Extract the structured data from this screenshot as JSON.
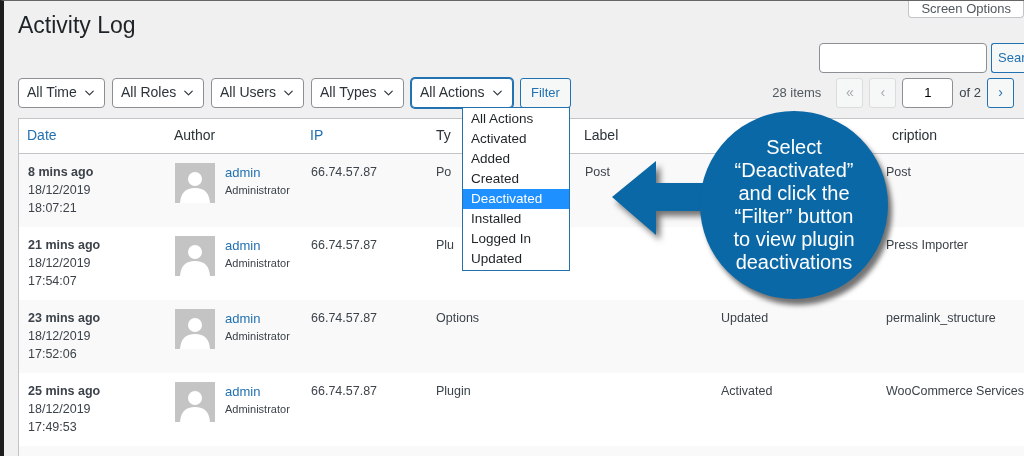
{
  "page": {
    "title": "Activity Log",
    "screen_options": "Screen Options",
    "search_button": "Sear"
  },
  "filters": [
    {
      "value": "All Time",
      "focused": false
    },
    {
      "value": "All Roles",
      "focused": false
    },
    {
      "value": "All Users",
      "focused": false
    },
    {
      "value": "All Types",
      "focused": false
    },
    {
      "value": "All Actions",
      "focused": true
    }
  ],
  "filter_button": "Filter",
  "pagination": {
    "items": "28 items",
    "first": {
      "label": "«",
      "disabled": true
    },
    "prev": {
      "label": "‹",
      "disabled": true
    },
    "page": "1",
    "total": "of 2",
    "next": {
      "label": "›",
      "disabled": false
    }
  },
  "table": {
    "columns": [
      {
        "label": "Date",
        "sortable": true
      },
      {
        "label": "Author",
        "sortable": false
      },
      {
        "label": "IP",
        "sortable": true
      },
      {
        "label": "Ty",
        "sortable": false
      },
      {
        "label": "Label",
        "sortable": false
      },
      {
        "label": "cription",
        "sortable": false
      }
    ],
    "rows": [
      {
        "relative": "8 mins ago",
        "date": "18/12/2019",
        "time": "18:07:21",
        "author": "admin",
        "role": "Administrator",
        "ip": "66.74.57.87",
        "type": "Po",
        "label": "Post",
        "description": "Post"
      },
      {
        "relative": "21 mins ago",
        "date": "18/12/2019",
        "time": "17:54:07",
        "author": "admin",
        "role": "Administrator",
        "ip": "66.74.57.87",
        "type": "Plu",
        "description": "Press Importer"
      },
      {
        "relative": "23 mins ago",
        "date": "18/12/2019",
        "time": "17:52:06",
        "author": "admin",
        "role": "Administrator",
        "ip": "66.74.57.87",
        "type": "Options",
        "action": "Updated",
        "description": "permalink_structure"
      },
      {
        "relative": "25 mins ago",
        "date": "18/12/2019",
        "time": "17:49:53",
        "author": "admin",
        "role": "Administrator",
        "ip": "66.74.57.87",
        "type": "Plugin",
        "action": "Activated",
        "description": "WooCommerce Services"
      }
    ]
  },
  "dropdown": {
    "options": [
      {
        "label": "All Actions",
        "selected": false
      },
      {
        "label": "Activated",
        "selected": false
      },
      {
        "label": "Added",
        "selected": false
      },
      {
        "label": "Created",
        "selected": false
      },
      {
        "label": "Deactivated",
        "selected": true
      },
      {
        "label": "Installed",
        "selected": false
      },
      {
        "label": "Logged In",
        "selected": false
      },
      {
        "label": "Updated",
        "selected": false
      }
    ]
  },
  "callout": {
    "text": "Select\n“Deactivated”\nand click the\n“Filter” button\nto view plugin\ndeactivations"
  }
}
